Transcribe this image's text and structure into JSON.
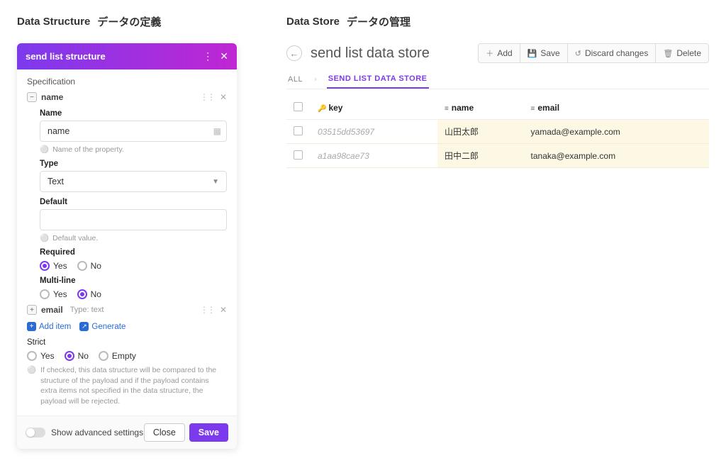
{
  "left": {
    "section_title_en": "Data Structure",
    "section_title_jp": "データの定義",
    "panel_title": "send list structure",
    "specification_label": "Specification",
    "props": {
      "name": {
        "key": "name",
        "name_label": "Name",
        "name_value": "name",
        "name_hint": "Name of the property.",
        "type_label": "Type",
        "type_value": "Text",
        "default_label": "Default",
        "default_value": "",
        "default_hint": "Default value.",
        "required_label": "Required",
        "required_yes": "Yes",
        "required_no": "No",
        "multiline_label": "Multi-line",
        "multiline_yes": "Yes",
        "multiline_no": "No"
      },
      "email": {
        "key": "email",
        "type_aux": "Type: text"
      }
    },
    "add_item_label": "Add item",
    "generate_label": "Generate",
    "strict_label": "Strict",
    "strict_yes": "Yes",
    "strict_no": "No",
    "strict_empty": "Empty",
    "strict_hint": "If checked, this data structure will be compared to the structure of the payload and if the payload contains extra items not specified in the data structure, the payload will be rejected.",
    "advanced_label": "Show advanced settings",
    "close_label": "Close",
    "save_label": "Save"
  },
  "right": {
    "section_title_en": "Data Store",
    "section_title_jp": "データの管理",
    "store_title": "send list data store",
    "actions": {
      "add": "Add",
      "save": "Save",
      "discard": "Discard changes",
      "delete": "Delete"
    },
    "tabs": {
      "all": "ALL",
      "current": "SEND LIST DATA STORE"
    },
    "columns": {
      "key": "key",
      "name": "name",
      "email": "email"
    },
    "rows": [
      {
        "key": "03515dd53697",
        "name": "山田太郎",
        "email": "yamada@example.com"
      },
      {
        "key": "a1aa98cae73",
        "name": "田中二郎",
        "email": "tanaka@example.com"
      }
    ]
  }
}
